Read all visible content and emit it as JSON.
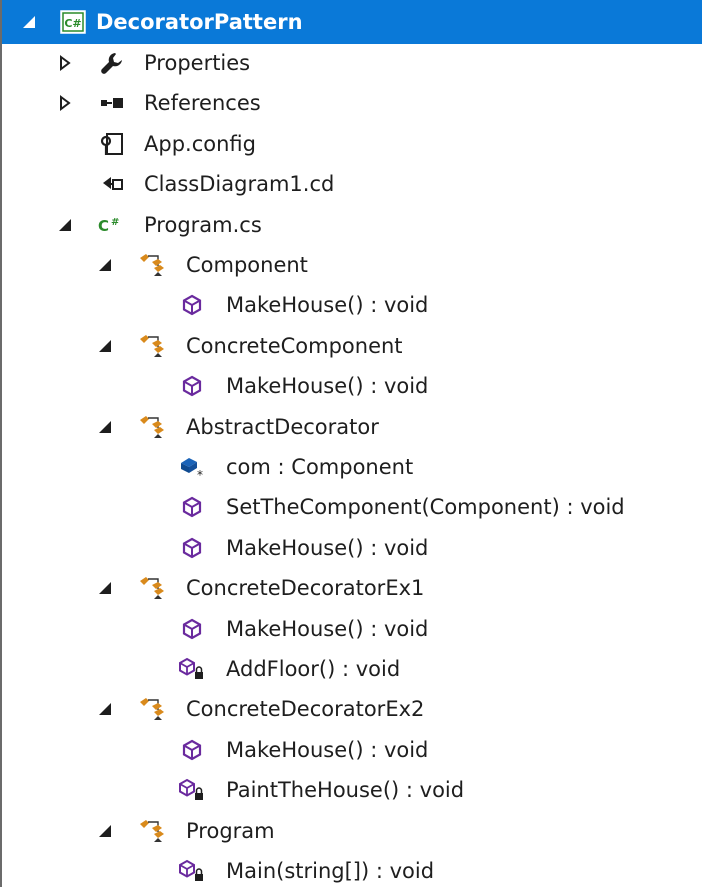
{
  "solution_explorer": {
    "project": {
      "label": "DecoratorPattern",
      "icon": "csharp-project-icon"
    },
    "items": [
      {
        "label": "Properties",
        "icon": "wrench-icon"
      },
      {
        "label": "References",
        "icon": "references-icon"
      },
      {
        "label": "App.config",
        "icon": "config-file-icon"
      },
      {
        "label": "ClassDiagram1.cd",
        "icon": "class-diagram-icon"
      },
      {
        "label": "Program.cs",
        "icon": "csharp-file-icon"
      }
    ],
    "classes": [
      {
        "label": "Component",
        "icon": "class-icon",
        "members": [
          {
            "label": "MakeHouse() : void",
            "icon": "method-icon"
          }
        ]
      },
      {
        "label": "ConcreteComponent",
        "icon": "class-icon",
        "members": [
          {
            "label": "MakeHouse() : void",
            "icon": "method-icon"
          }
        ]
      },
      {
        "label": "AbstractDecorator",
        "icon": "class-icon",
        "members": [
          {
            "label": "com : Component",
            "icon": "protected-field-icon"
          },
          {
            "label": "SetTheComponent(Component) : void",
            "icon": "method-icon"
          },
          {
            "label": "MakeHouse() : void",
            "icon": "method-icon"
          }
        ]
      },
      {
        "label": "ConcreteDecoratorEx1",
        "icon": "class-icon",
        "members": [
          {
            "label": "MakeHouse() : void",
            "icon": "method-icon"
          },
          {
            "label": "AddFloor() : void",
            "icon": "private-method-icon"
          }
        ]
      },
      {
        "label": "ConcreteDecoratorEx2",
        "icon": "class-icon",
        "members": [
          {
            "label": "MakeHouse() : void",
            "icon": "method-icon"
          },
          {
            "label": "PaintTheHouse() : void",
            "icon": "private-method-icon"
          }
        ]
      },
      {
        "label": "Program",
        "icon": "class-icon",
        "members": [
          {
            "label": "Main(string[]) : void",
            "icon": "private-method-icon"
          }
        ]
      }
    ]
  },
  "colors": {
    "selection": "#0a79d8",
    "method": "#6a2a9e",
    "class": "#d98a1c",
    "field": "#1a63b8",
    "csharp": "#2a8a2a"
  }
}
